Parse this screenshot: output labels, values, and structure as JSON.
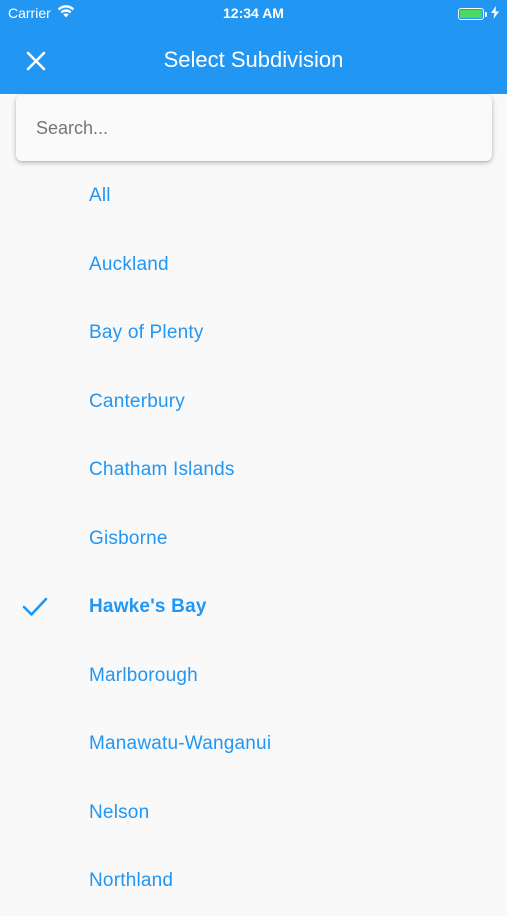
{
  "status_bar": {
    "carrier": "Carrier",
    "time": "12:34 AM",
    "battery_level": 1.0
  },
  "app_bar": {
    "title": "Select Subdivision",
    "close_icon": "close-icon"
  },
  "search": {
    "placeholder": "Search...",
    "value": ""
  },
  "colors": {
    "accent": "#2196f3",
    "background": "#f9f9f9"
  },
  "list": {
    "items": [
      {
        "label": "All",
        "selected": false
      },
      {
        "label": "Auckland",
        "selected": false
      },
      {
        "label": "Bay of Plenty",
        "selected": false
      },
      {
        "label": "Canterbury",
        "selected": false
      },
      {
        "label": "Chatham Islands",
        "selected": false
      },
      {
        "label": "Gisborne",
        "selected": false
      },
      {
        "label": "Hawke's Bay",
        "selected": true
      },
      {
        "label": "Marlborough",
        "selected": false
      },
      {
        "label": "Manawatu-Wanganui",
        "selected": false
      },
      {
        "label": "Nelson",
        "selected": false
      },
      {
        "label": "Northland",
        "selected": false
      }
    ]
  }
}
